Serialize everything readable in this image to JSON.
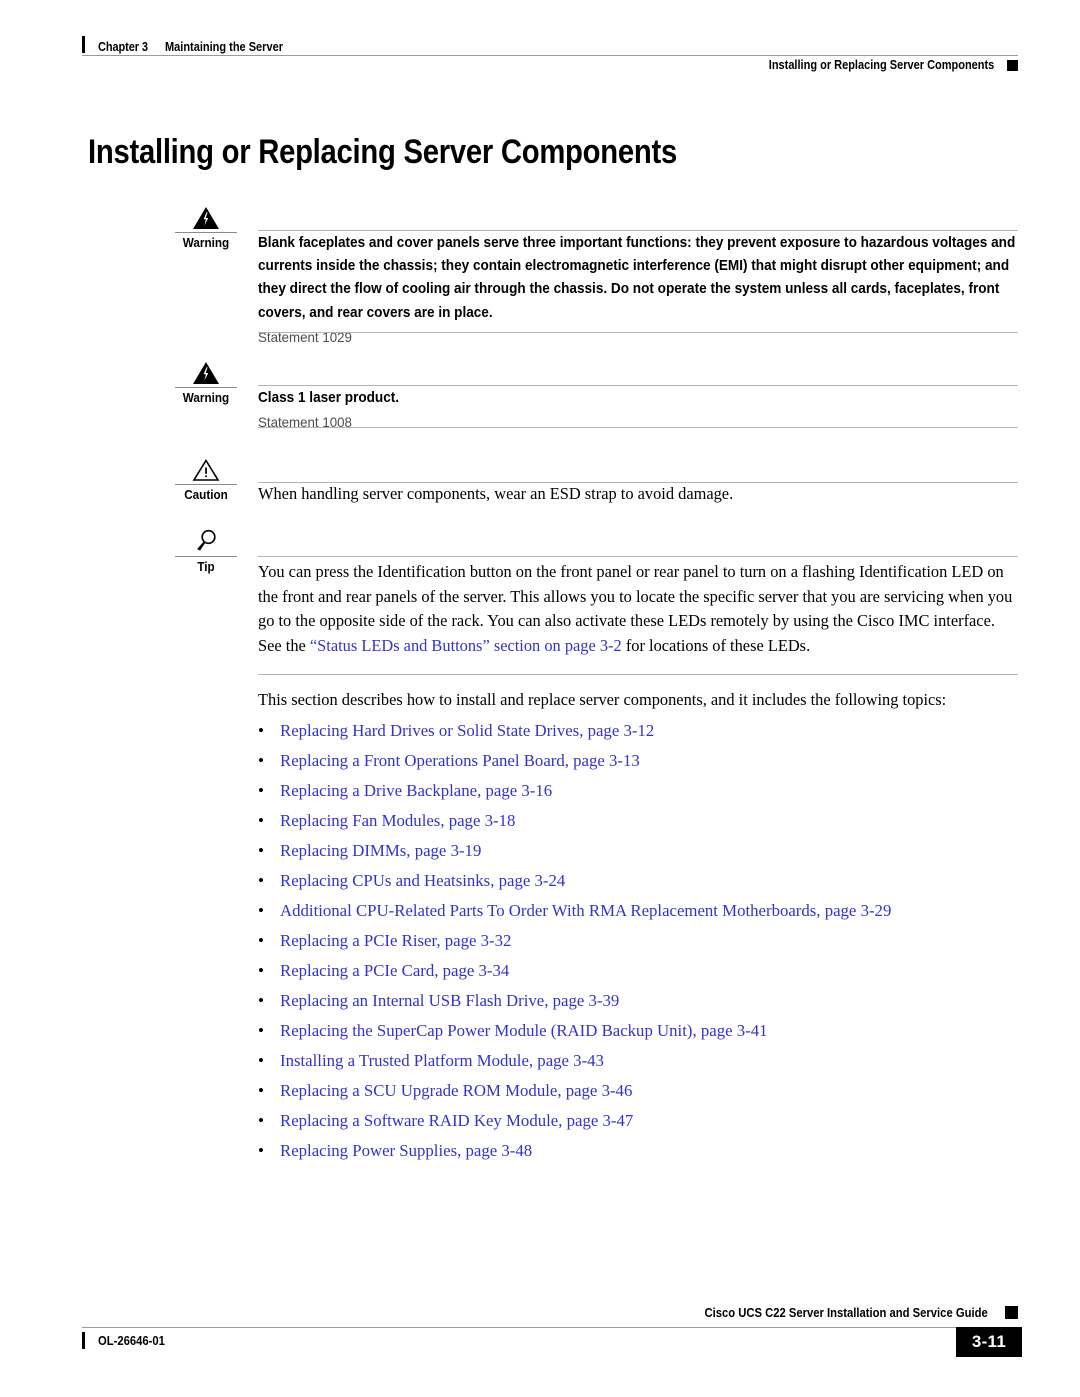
{
  "header": {
    "chapter": "Chapter 3",
    "chapter_title": "Maintaining the Server",
    "section": "Installing or Replacing Server Components"
  },
  "title": "Installing or Replacing Server Components",
  "admonitions": [
    {
      "label": "Warning",
      "icon": "warning-lightning-triangle-icon",
      "text": "Blank faceplates and cover panels serve three important functions: they prevent exposure to hazardous voltages and currents inside the chassis; they contain electromagnetic interference (EMI) that might disrupt other equipment; and they direct the flow of cooling air through the chassis. Do not operate the system unless all cards, faceplates, front covers, and rear covers are in place.",
      "statement": "Statement 1029"
    },
    {
      "label": "Warning",
      "icon": "warning-lightning-triangle-icon",
      "text": "Class 1 laser product.",
      "statement": "Statement 1008"
    },
    {
      "label": "Caution",
      "icon": "caution-exclamation-triangle-icon",
      "text": "When handling server components, wear an ESD strap to avoid damage.",
      "statement": ""
    },
    {
      "label": "Tip",
      "icon": "magnifying-glass-icon",
      "text_before_link": "You can press the Identification button on the front panel or rear panel to turn on a flashing Identification LED on the front and rear panels of the server. This allows you to locate the specific server that you are servicing when you go to the opposite side of the rack. You can also activate these LEDs remotely by using the Cisco IMC interface. See the ",
      "link_text": "“Status LEDs and Buttons” section on page 3-2",
      "text_after_link": " for locations of these LEDs.",
      "statement": ""
    }
  ],
  "section_intro": "This section describes how to install and replace server components, and it includes the following topics:",
  "topics": [
    {
      "bullet": "•",
      "label": "Replacing Hard Drives or Solid State Drives, page 3-12"
    },
    {
      "bullet": "•",
      "label": "Replacing a Front Operations Panel Board, page 3-13"
    },
    {
      "bullet": "•",
      "label": "Replacing a Drive Backplane, page 3-16"
    },
    {
      "bullet": "•",
      "label": "Replacing Fan Modules, page 3-18"
    },
    {
      "bullet": "•",
      "label": "Replacing DIMMs, page 3-19"
    },
    {
      "bullet": "•",
      "label": "Replacing CPUs and Heatsinks, page 3-24"
    },
    {
      "bullet": "•",
      "label": "Additional CPU-Related Parts To Order With RMA Replacement Motherboards, page 3-29"
    },
    {
      "bullet": "•",
      "label": "Replacing a PCIe Riser, page 3-32"
    },
    {
      "bullet": "•",
      "label": "Replacing a PCIe Card, page 3-34"
    },
    {
      "bullet": "•",
      "label": "Replacing an Internal USB Flash Drive, page 3-39"
    },
    {
      "bullet": "•",
      "label": "Replacing the SuperCap Power Module (RAID Backup Unit), page 3-41"
    },
    {
      "bullet": "•",
      "label": "Installing a Trusted Platform Module, page 3-43"
    },
    {
      "bullet": "•",
      "label": "Replacing a SCU Upgrade ROM Module, page 3-46"
    },
    {
      "bullet": "•",
      "label": "Replacing a Software RAID Key Module, page 3-47"
    },
    {
      "bullet": "•",
      "label": "Replacing Power Supplies, page 3-48"
    }
  ],
  "footer": {
    "guide_title": "Cisco UCS C22 Server Installation and Service Guide",
    "doc_number": "OL-26646-01",
    "page_number": "3-11"
  },
  "colors": {
    "link": "#3333CC",
    "statement_gray": "#4D4D4D",
    "rule_gray": "#B3B3B3"
  }
}
